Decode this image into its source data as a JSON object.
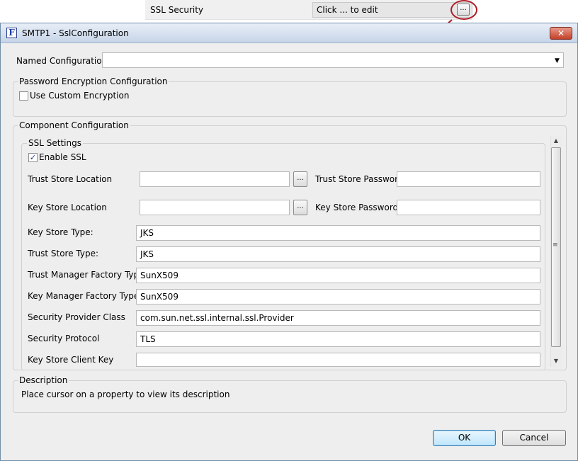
{
  "property_row": {
    "label": "SSL Security",
    "value": "Click ... to edit",
    "button_label": "..."
  },
  "dialog": {
    "icon_letter": "F",
    "title": "SMTP1 - SslConfiguration",
    "close_label": "✕"
  },
  "named_configuration": {
    "label": "Named Configuration",
    "value": ""
  },
  "password_encryption": {
    "group_title": "Password Encryption Configuration",
    "use_custom_label": "Use Custom Encryption",
    "use_custom_checked": false
  },
  "component_configuration": {
    "group_title": "Component Configuration",
    "ssl_settings": {
      "group_title": "SSL Settings",
      "enable_ssl_label": "Enable SSL",
      "enable_ssl_checked": true,
      "checkmark": "✓",
      "browse_label": "...",
      "trust_store_location": {
        "label": "Trust Store Location",
        "value": ""
      },
      "trust_store_password": {
        "label": "Trust Store Password",
        "value": ""
      },
      "key_store_location": {
        "label": "Key Store Location",
        "value": ""
      },
      "key_store_password": {
        "label": "Key Store Password",
        "value": ""
      },
      "key_store_type": {
        "label": "Key Store Type:",
        "value": "JKS"
      },
      "trust_store_type": {
        "label": "Trust Store Type:",
        "value": "JKS"
      },
      "trust_manager_factory_type": {
        "label": "Trust Manager Factory Type",
        "value": "SunX509"
      },
      "key_manager_factory_type": {
        "label": "Key Manager Factory Type",
        "value": "SunX509"
      },
      "security_provider_class": {
        "label": "Security Provider Class",
        "value": "com.sun.net.ssl.internal.ssl.Provider"
      },
      "security_protocol": {
        "label": "Security Protocol",
        "value": "TLS"
      },
      "key_store_client_key": {
        "label": "Key Store Client Key",
        "value": ""
      }
    }
  },
  "description": {
    "group_title": "Description",
    "text": "Place cursor on a property to view its description"
  },
  "buttons": {
    "ok": "OK",
    "cancel": "Cancel"
  },
  "icons": {
    "scroll_up": "▲",
    "scroll_down": "▼",
    "scroll_grip": "≡",
    "dropdown": "▼"
  },
  "colors": {
    "highlight_ring": "#b01c26",
    "close_button": "#c4402a",
    "default_button_border": "#3c7fb1"
  }
}
